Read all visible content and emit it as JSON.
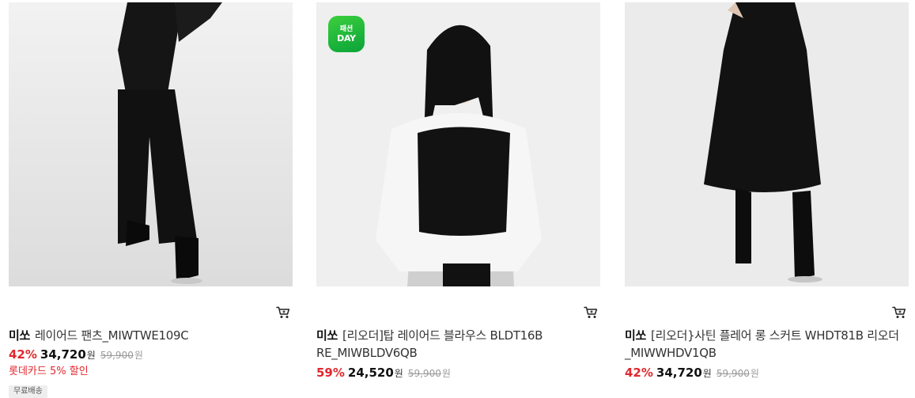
{
  "products": [
    {
      "brand": "미쏘",
      "name": "레이어드 팬츠_MIWTWE109C",
      "discount": "42%",
      "price": "34,720",
      "currency": "원",
      "original_price": "59,900",
      "promo": "롯데카드 5% 할인",
      "tag": "무료배송",
      "icon": "cart-icon"
    },
    {
      "brand": "미쏘",
      "name": "[리오더]탑 레이어드 블라우스 BLDT16B RE_MIWBLDV6QB",
      "discount": "59%",
      "price": "24,520",
      "currency": "원",
      "original_price": "59,900",
      "badge_top": "패션",
      "badge_bottom": "DAY",
      "icon": "cart-icon"
    },
    {
      "brand": "미쏘",
      "name": "[리오더}사틴 플레어 롱 스커트 WHDT81B 리오더_MIWWHDV1QB",
      "discount": "42%",
      "price": "34,720",
      "currency": "원",
      "original_price": "59,900",
      "icon": "cart-icon"
    }
  ],
  "colors": {
    "discount": "#e0282e",
    "badge": "#1fb53a"
  }
}
